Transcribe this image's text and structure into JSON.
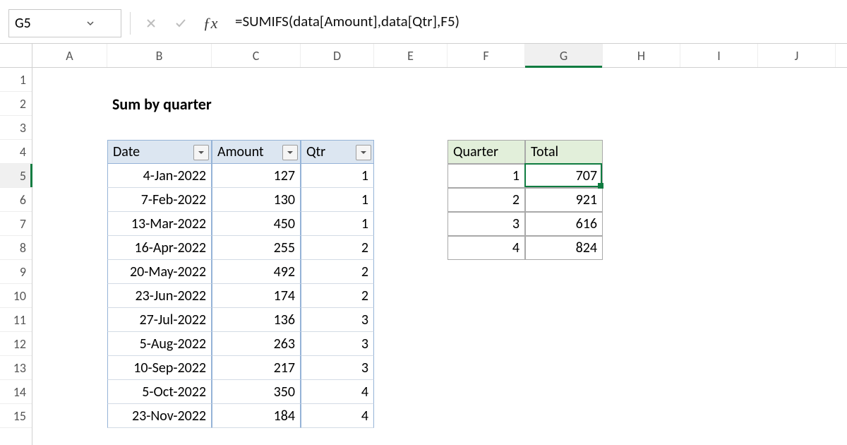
{
  "namebox": "G5",
  "formula": "=SUMIFS(data[Amount],data[Qtr],F5)",
  "title": "Sum by quarter",
  "columns_visible": [
    "A",
    "B",
    "C",
    "D",
    "E",
    "F",
    "G",
    "H",
    "I",
    "J"
  ],
  "rows_visible": [
    "1",
    "2",
    "3",
    "4",
    "5",
    "6",
    "7",
    "8",
    "9",
    "10",
    "11",
    "12",
    "13",
    "14",
    "15"
  ],
  "col_widths": {
    "A": 106,
    "B": 148,
    "C": 126,
    "D": 104,
    "E": 104,
    "F": 110,
    "G": 110,
    "H": 110,
    "I": 110,
    "J": 110
  },
  "active": {
    "col": "G",
    "row": 5
  },
  "table": {
    "headers": [
      "Date",
      "Amount",
      "Qtr"
    ],
    "rows": [
      {
        "date": "4-Jan-2022",
        "amount": 127,
        "qtr": 1
      },
      {
        "date": "7-Feb-2022",
        "amount": 130,
        "qtr": 1
      },
      {
        "date": "13-Mar-2022",
        "amount": 450,
        "qtr": 1
      },
      {
        "date": "16-Apr-2022",
        "amount": 255,
        "qtr": 2
      },
      {
        "date": "20-May-2022",
        "amount": 492,
        "qtr": 2
      },
      {
        "date": "23-Jun-2022",
        "amount": 174,
        "qtr": 2
      },
      {
        "date": "27-Jul-2022",
        "amount": 136,
        "qtr": 3
      },
      {
        "date": "5-Aug-2022",
        "amount": 263,
        "qtr": 3
      },
      {
        "date": "10-Sep-2022",
        "amount": 217,
        "qtr": 3
      },
      {
        "date": "5-Oct-2022",
        "amount": 350,
        "qtr": 4
      },
      {
        "date": "23-Nov-2022",
        "amount": 184,
        "qtr": 4
      }
    ]
  },
  "summary": {
    "headers": [
      "Quarter",
      "Total"
    ],
    "rows": [
      {
        "quarter": 1,
        "total": 707
      },
      {
        "quarter": 2,
        "total": 921
      },
      {
        "quarter": 3,
        "total": 616
      },
      {
        "quarter": 4,
        "total": 824
      }
    ]
  }
}
